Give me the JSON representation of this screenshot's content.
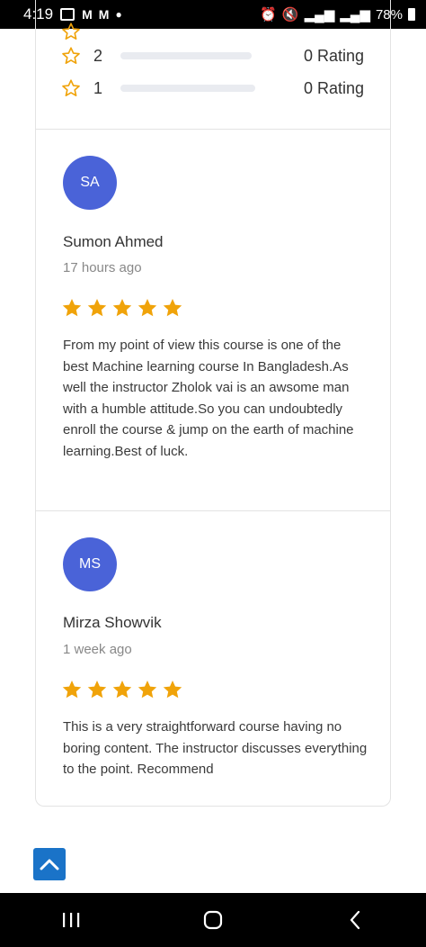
{
  "status_bar": {
    "time": "4:19",
    "battery": "78%"
  },
  "rating_rows": [
    {
      "stars": "2",
      "label": "0 Rating"
    },
    {
      "stars": "1",
      "label": "0 Rating"
    }
  ],
  "reviews": [
    {
      "initials": "SA",
      "name": "Sumon Ahmed",
      "time": "17 hours ago",
      "rating": 5,
      "text": "From my point of view this course is one of the best Machine learning course In Bangladesh.As well the instructor Zholok vai is an awsome man with a humble attitude.So you can undoubtedly enroll the course & jump on the earth of machine learning.Best of luck."
    },
    {
      "initials": "MS",
      "name": "Mirza Showvik",
      "time": "1 week ago",
      "rating": 5,
      "text": "This is a very straightforward course having no boring content. The instructor discusses everything to the point. Recommend"
    }
  ],
  "colors": {
    "star": "#f0a30a",
    "avatar": "#4a63d8",
    "scroll_button": "#1a73c8"
  },
  "icons": {
    "scroll_top": "chevron-up-icon",
    "nav_recents": "recents-icon",
    "nav_home": "home-icon",
    "nav_back": "back-icon"
  }
}
